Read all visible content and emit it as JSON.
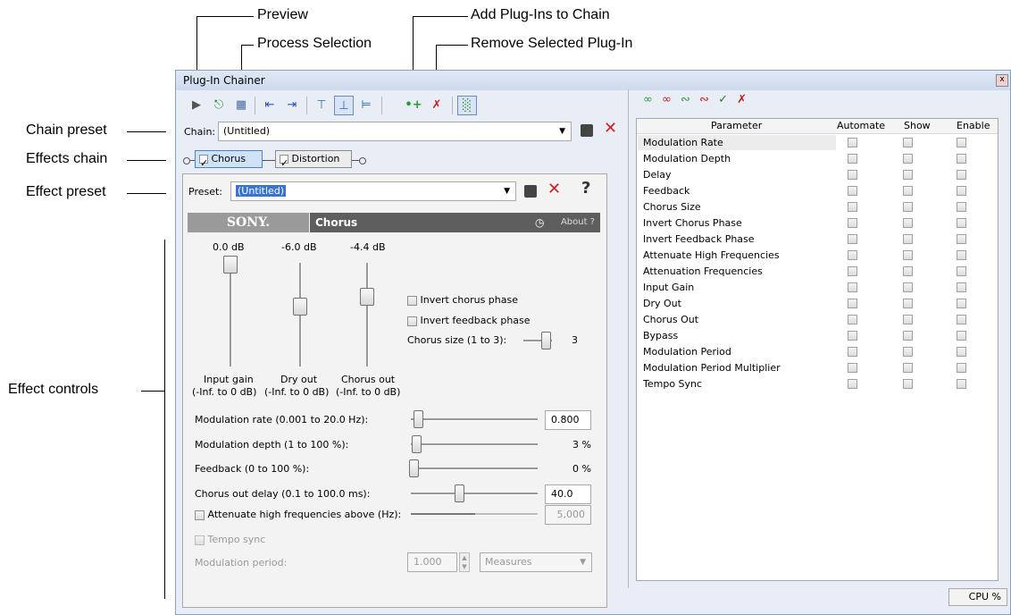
{
  "callouts": {
    "preview": "Preview",
    "process_selection": "Process Selection",
    "add_plugins": "Add Plug-Ins to Chain",
    "remove_plugin": "Remove Selected Plug-In",
    "chain_preset": "Chain preset",
    "effects_chain": "Effects chain",
    "effect_preset": "Effect preset",
    "effect_controls": "Effect controls"
  },
  "window": {
    "title": "Plug-In Chainer",
    "close": "x"
  },
  "chain": {
    "label": "Chain:",
    "value": "(Untitled)",
    "plugins": [
      "Chorus",
      "Distortion"
    ]
  },
  "preset": {
    "label": "Preset:",
    "value": "(Untitled)",
    "help": "?"
  },
  "plugin_header": {
    "brand": "SONY.",
    "name": "Chorus",
    "about": "About ?"
  },
  "faders": [
    {
      "value_label": "0.0 dB",
      "name_line1": "Input gain",
      "name_line2": "(-Inf. to 0 dB)",
      "level": 1.0
    },
    {
      "value_label": "-6.0 dB",
      "name_line1": "Dry out",
      "name_line2": "(-Inf. to 0 dB)",
      "level": 0.75
    },
    {
      "value_label": "-4.4 dB",
      "name_line1": "Chorus out",
      "name_line2": "(-Inf. to 0 dB)",
      "level": 0.82
    }
  ],
  "checks": {
    "invert_chorus": "Invert chorus phase",
    "invert_feedback": "Invert feedback phase",
    "chorus_size_label": "Chorus size (1 to 3):",
    "chorus_size_value": "3"
  },
  "params": [
    {
      "label": "Modulation rate (0.001 to 20.0 Hz):",
      "value": "0.800",
      "boxed": true,
      "fraction": 0.04
    },
    {
      "label": "Modulation depth (1 to 100 %):",
      "value": "3 %",
      "boxed": false,
      "fraction": 0.02
    },
    {
      "label": "Feedback (0 to 100 %):",
      "value": "0 %",
      "boxed": false,
      "fraction": 0.0
    },
    {
      "label": "Chorus out delay (0.1 to 100.0 ms):",
      "value": "40.0",
      "boxed": true,
      "fraction": 0.4
    }
  ],
  "attenuate": {
    "label": "Attenuate high frequencies above (Hz):",
    "value": "5,000"
  },
  "tempo_sync": {
    "label": "Tempo sync"
  },
  "mod_period": {
    "label": "Modulation period:",
    "value": "1.000",
    "unit": "Measures"
  },
  "param_table": {
    "headers": [
      "Parameter",
      "Automate",
      "Show",
      "Enable"
    ],
    "rows": [
      "Modulation Rate",
      "Modulation Depth",
      "Delay",
      "Feedback",
      "Chorus Size",
      "Invert Chorus Phase",
      "Invert Feedback Phase",
      "Attenuate High Frequencies",
      "Attenuation Frequencies",
      "Input Gain",
      "Dry Out",
      "Chorus Out",
      "Bypass",
      "Modulation Period",
      "Modulation Period Multiplier",
      "Tempo Sync"
    ]
  },
  "status": {
    "cpu": "CPU %"
  }
}
